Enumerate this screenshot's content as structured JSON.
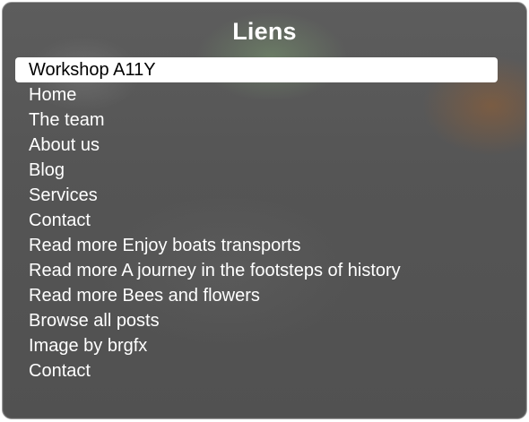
{
  "rotor": {
    "title": "Liens",
    "selected_index": 0,
    "items": [
      {
        "label": "Workshop A11Y"
      },
      {
        "label": "Home"
      },
      {
        "label": "The team"
      },
      {
        "label": "About us"
      },
      {
        "label": "Blog"
      },
      {
        "label": "Services"
      },
      {
        "label": "Contact"
      },
      {
        "label": "Read more Enjoy boats transports"
      },
      {
        "label": "Read more A journey in the footsteps of history"
      },
      {
        "label": "Read more Bees and flowers"
      },
      {
        "label": "Browse all posts"
      },
      {
        "label": "Image by brgfx"
      },
      {
        "label": "Contact"
      }
    ]
  },
  "colors": {
    "panel_background": "#555555",
    "text": "#ffffff",
    "selected_background": "#ffffff",
    "selected_text": "#000000"
  }
}
